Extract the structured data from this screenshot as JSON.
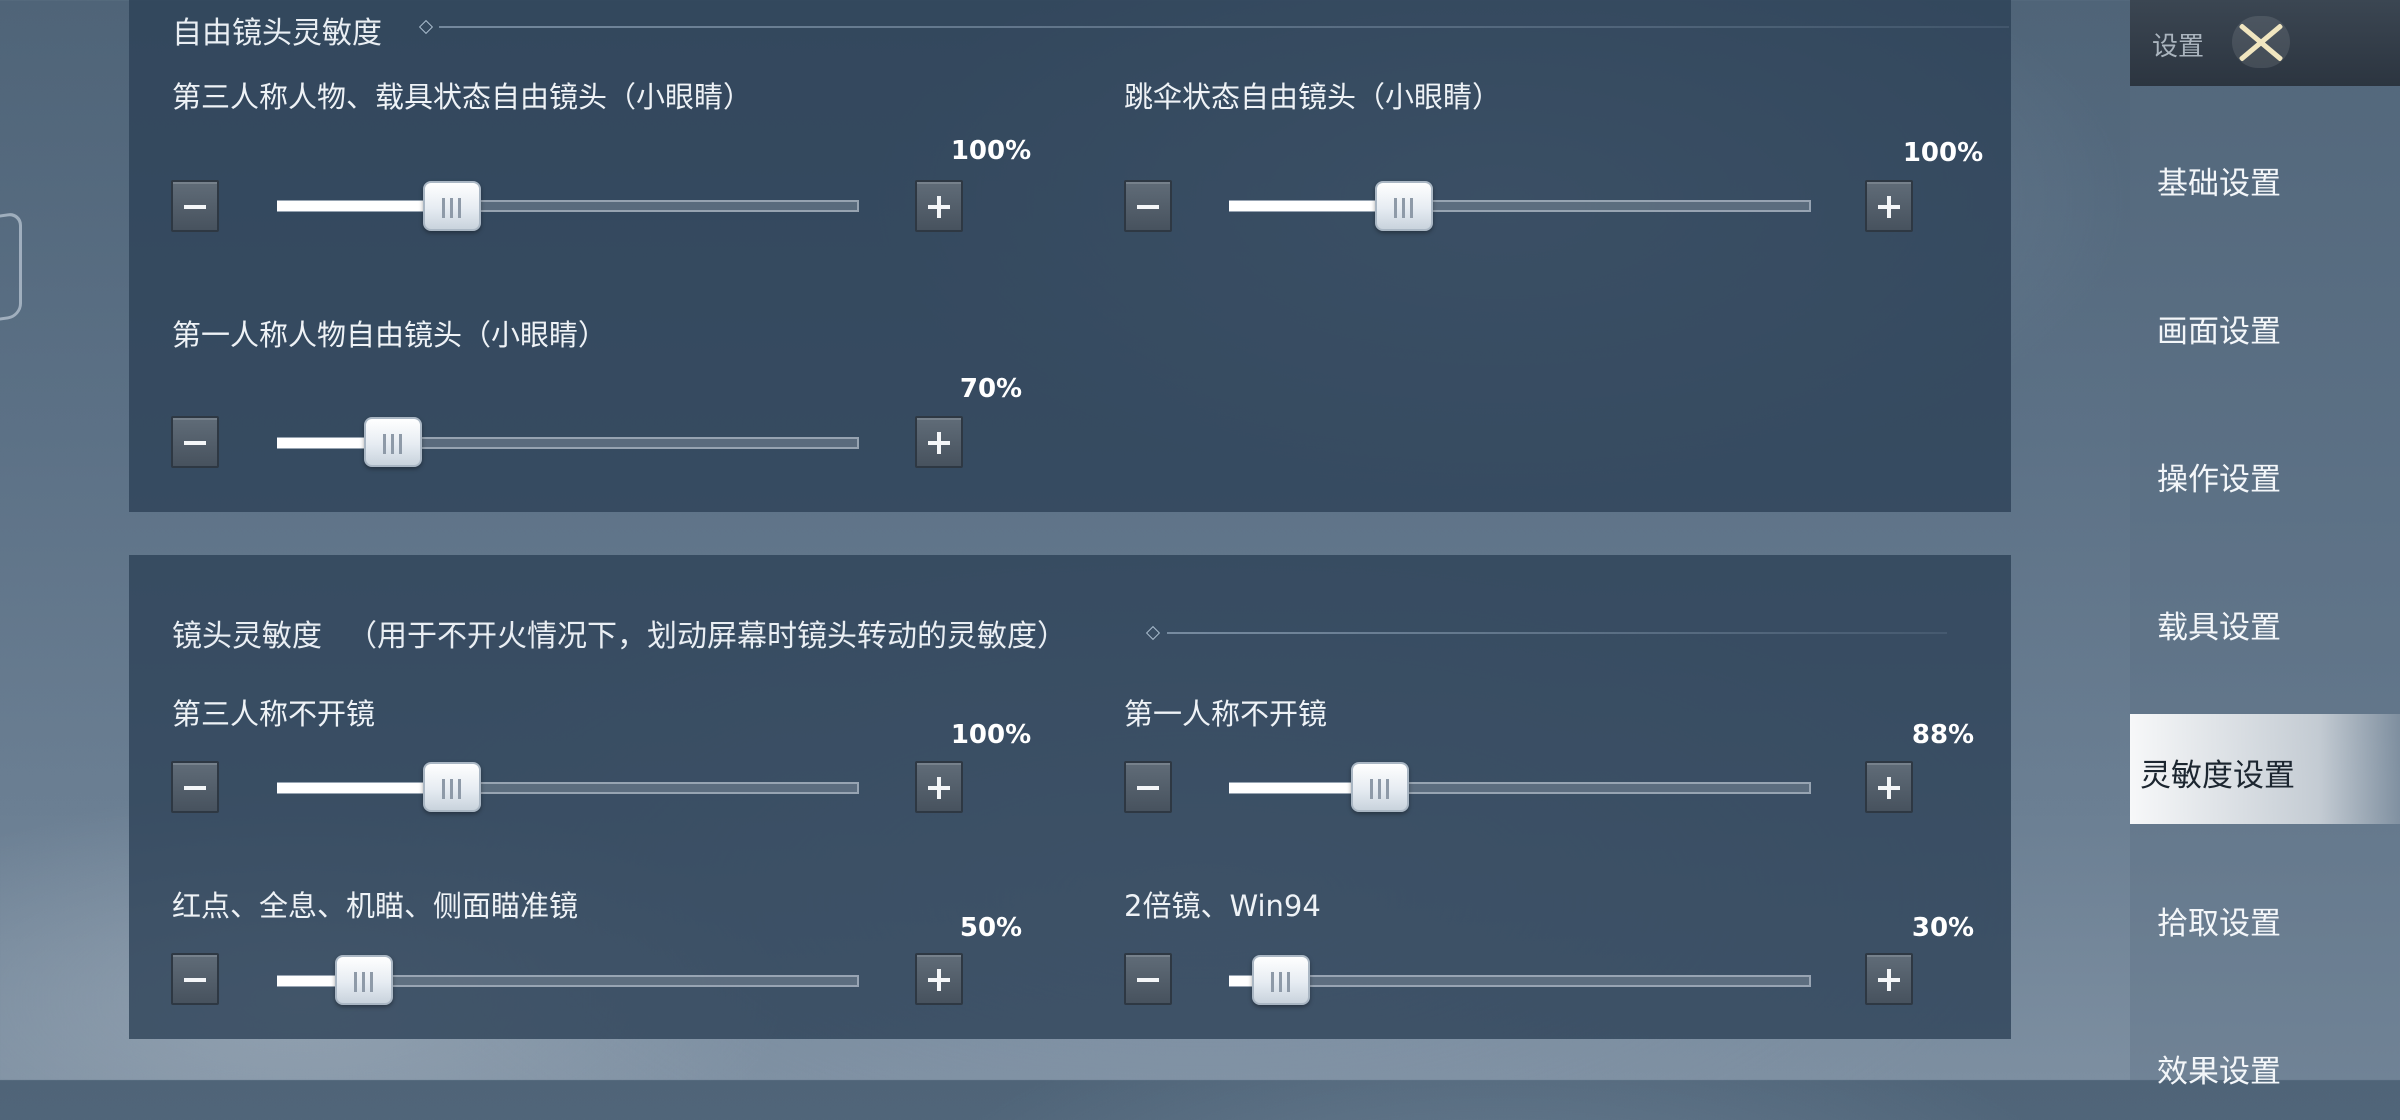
{
  "sections": [
    {
      "title": "自由镜头灵敏度",
      "controls": [
        {
          "label": "第三人称人物、载具状态自由镜头（小眼睛）",
          "percent": "100%",
          "value": 0.3
        },
        {
          "label": "跳伞状态自由镜头（小眼睛）",
          "percent": "100%",
          "value": 0.3
        },
        {
          "label": "第一人称人物自由镜头（小眼睛）",
          "percent": "70%",
          "value": 0.2
        }
      ]
    },
    {
      "title": "镜头灵敏度",
      "subtitle": "（用于不开火情况下，划动屏幕时镜头转动的灵敏度）",
      "controls": [
        {
          "label": "第三人称不开镜",
          "percent": "100%",
          "value": 0.3
        },
        {
          "label": "第一人称不开镜",
          "percent": "88%",
          "value": 0.26
        },
        {
          "label": "红点、全息、机瞄、侧面瞄准镜",
          "percent": "50%",
          "value": 0.15
        },
        {
          "label": "2倍镜、Win94",
          "percent": "30%",
          "value": 0.09
        }
      ]
    }
  ],
  "sidebar": {
    "title": "设置",
    "close_icon": "close-x-icon",
    "items": [
      {
        "label": "基础设置"
      },
      {
        "label": "画面设置"
      },
      {
        "label": "操作设置"
      },
      {
        "label": "载具设置"
      },
      {
        "label": "灵敏度设置",
        "active": true
      },
      {
        "label": "拾取设置"
      },
      {
        "label": "效果设置"
      }
    ]
  },
  "icons": {
    "minus": "minus-icon",
    "plus": "plus-icon",
    "slider_grip": "grip-lines-icon"
  }
}
